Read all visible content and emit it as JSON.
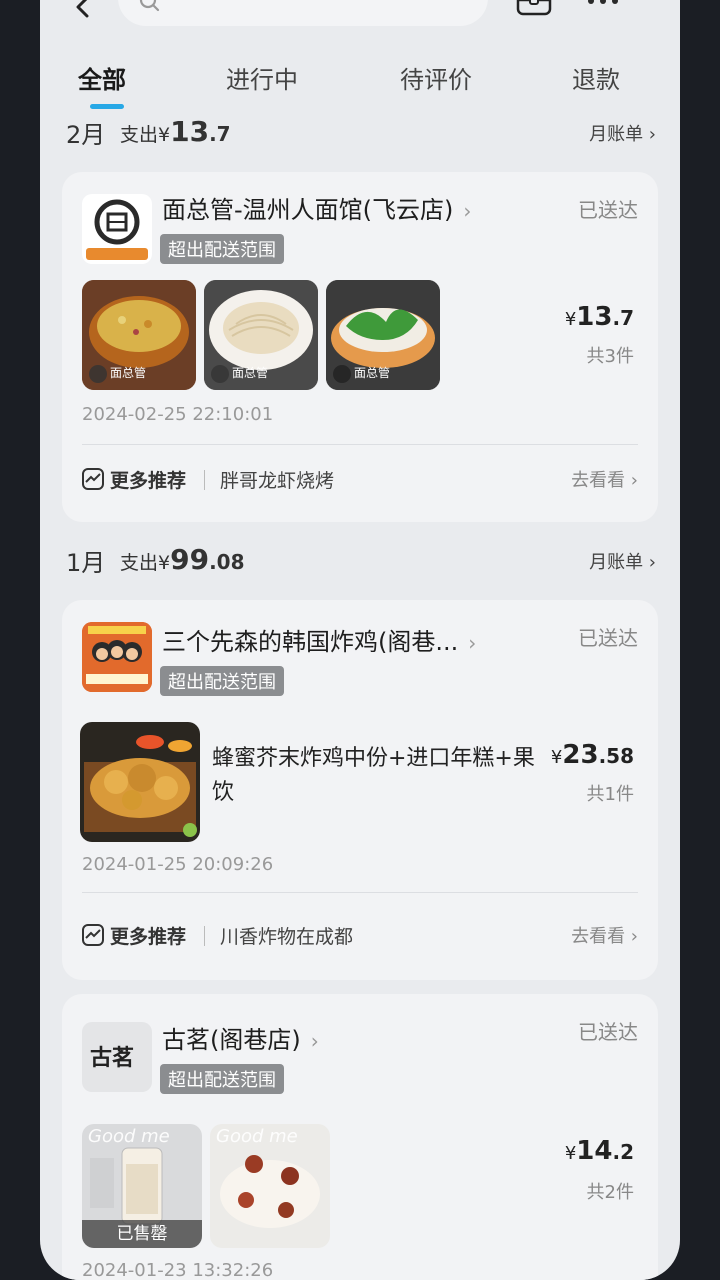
{
  "tabs": [
    {
      "label": "全部",
      "active": true
    },
    {
      "label": "进行中",
      "active": false
    },
    {
      "label": "待评价",
      "active": false
    },
    {
      "label": "退款",
      "active": false
    }
  ],
  "colors": {
    "accent": "#27a8e6",
    "badge": "#8b8d90",
    "page_bg": "#e9ebee"
  },
  "months": [
    {
      "month": "2月",
      "spend_prefix": "支出¥",
      "spend_int": "13",
      "spend_dec": ".7",
      "bill_link": "月账单 ›"
    },
    {
      "month": "1月",
      "spend_prefix": "支出¥",
      "spend_int": "99",
      "spend_dec": ".08",
      "bill_link": "月账单 ›"
    }
  ],
  "orders": [
    {
      "store": "面总管-温州人面馆(飞云店)",
      "badge": "超出配送范围",
      "status": "已送达",
      "price_symbol": "¥",
      "price_int": "13",
      "price_dec": ".7",
      "count": "共3件",
      "time": "2024-02-25 22:10:01",
      "recommend_title": "更多推荐",
      "recommend_name": "胖哥龙虾烧烤",
      "recommend_go": "去看看 ›",
      "thumb_brand": "面总管"
    },
    {
      "store": "三个先森的韩国炸鸡(阁巷...",
      "badge": "超出配送范围",
      "status": "已送达",
      "item_desc": "蜂蜜芥末炸鸡中份+进口年糕+果饮",
      "price_symbol": "¥",
      "price_int": "23",
      "price_dec": ".58",
      "count": "共1件",
      "time": "2024-01-25 20:09:26",
      "recommend_title": "更多推荐",
      "recommend_name": "川香炸物在成都",
      "recommend_go": "去看看 ›"
    },
    {
      "store": "古茗(阁巷店)",
      "logo_text": "古茗",
      "badge": "超出配送范围",
      "status": "已送达",
      "price_symbol": "¥",
      "price_int": "14",
      "price_dec": ".2",
      "count": "共2件",
      "time": "2024-01-23 13:32:26",
      "soldout": "已售罄",
      "thumb_watermark": "Good me"
    }
  ]
}
